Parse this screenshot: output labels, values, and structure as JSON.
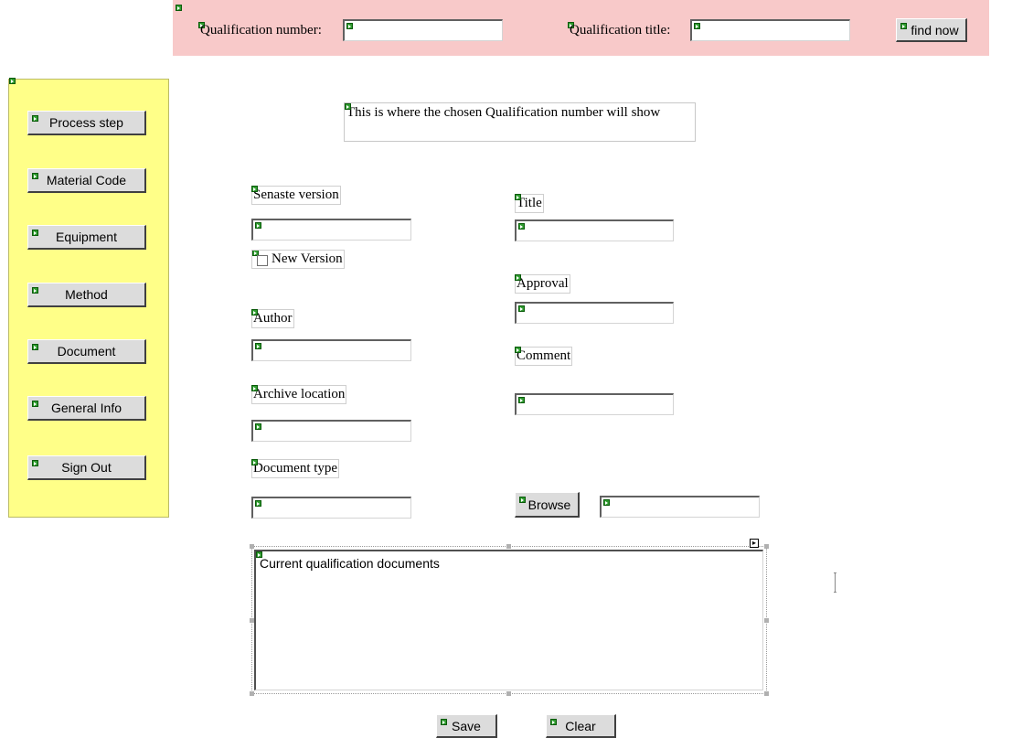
{
  "search_bar": {
    "qualification_number_label": "Qualification number:",
    "qualification_number_value": "",
    "qualification_title_label": "Qualification title:",
    "qualification_title_value": "",
    "find_button": "find now"
  },
  "sidebar": {
    "items": [
      {
        "label": "Process step"
      },
      {
        "label": "Material Code"
      },
      {
        "label": "Equipment"
      },
      {
        "label": "Method"
      },
      {
        "label": "Document"
      },
      {
        "label": "General Info"
      },
      {
        "label": "Sign Out"
      }
    ]
  },
  "main": {
    "chosen_qualification_text": "This is where the chosen Qualification number will show",
    "senaste_version_label": "Senaste version",
    "new_version_label": "New Version",
    "author_label": "Author",
    "archive_location_label": "Archive location",
    "document_type_label": "Document type",
    "title_label": "Title",
    "approval_label": "Approval",
    "comment_label": "Comment",
    "browse_button": "Browse",
    "documents_list_header": "Current qualification documents",
    "save_button": "Save",
    "clear_button": "Clear"
  },
  "colors": {
    "search_bar_bg": "#f8c9c9",
    "sidebar_bg": "#ffff88",
    "button_bg": "#dcdcdc"
  }
}
